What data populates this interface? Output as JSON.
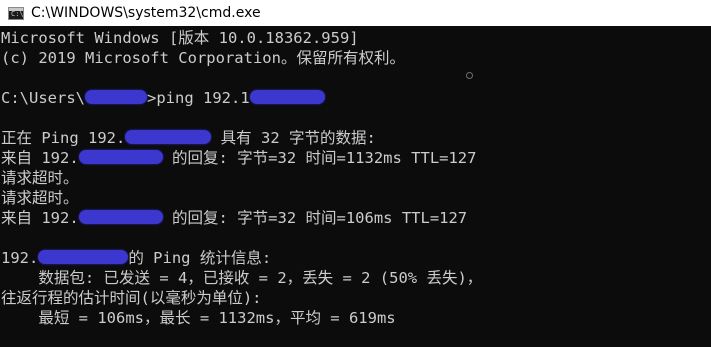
{
  "window": {
    "title": "C:\\WINDOWS\\system32\\cmd.exe",
    "icon": "cmd-window-icon",
    "icon_glyph": "C:\\"
  },
  "console": {
    "banner_line1": "Microsoft Windows [版本 10.0.18362.959]",
    "banner_line2": "(c) 2019 Microsoft Corporation。保留所有权利。",
    "prompt_prefix": "C:\\Users\\",
    "prompt_symbol": ">",
    "command": "ping 192.1",
    "ping_start_prefix": "正在 Ping 192.",
    "ping_start_suffix": " 具有 32 字节的数据:",
    "reply1_prefix": "来自 192.",
    "reply1_suffix": " 的回复: 字节=32 时间=1132ms TTL=127",
    "timeout1": "请求超时。",
    "timeout2": "请求超时。",
    "reply2_prefix": "来自 192.",
    "reply2_suffix": " 的回复: 字节=32 时间=106ms TTL=127",
    "stats_prefix": "192.",
    "stats_suffix": "的 Ping 统计信息:",
    "packets_line": "    数据包: 已发送 = 4，已接收 = 2，丢失 = 2 (50% 丢失)，",
    "rtt_header": "往返行程的估计时间(以毫秒为单位):",
    "rtt_values": "    最短 = 106ms，最长 = 1132ms，平均 = 619ms",
    "text_color": "#cccccc",
    "background_color": "#0c0c0c",
    "redaction_color": "#3b37cf"
  }
}
